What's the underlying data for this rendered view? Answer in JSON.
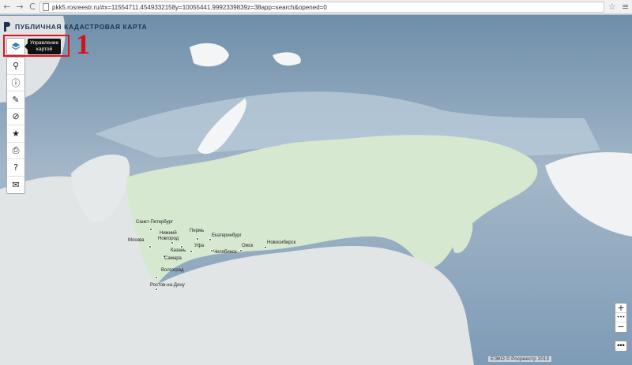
{
  "browser": {
    "back": "←",
    "forward": "→",
    "reload": "C",
    "url": "pkk5.rosreestr.ru/#x=11554711.4549332158y=10055441.9992339839z=38app=search&opened=0",
    "star": "☆",
    "menu": "≡"
  },
  "app": {
    "title": "ПУБЛИЧНАЯ КАДАСТРОВАЯ КАРТА"
  },
  "tooltip": {
    "text": "Управление картой"
  },
  "annotation": {
    "number": "1"
  },
  "toolbar": {
    "layers_icon": "layers-icon",
    "tools": [
      {
        "icon": "search-icon",
        "glyph": "⚲"
      },
      {
        "icon": "info-icon",
        "glyph": "ⓘ"
      },
      {
        "icon": "pencil-icon",
        "glyph": "✎"
      },
      {
        "icon": "no-measure-icon",
        "glyph": "⊘"
      },
      {
        "icon": "star-icon",
        "glyph": "★"
      },
      {
        "icon": "print-icon",
        "glyph": "⎙"
      },
      {
        "icon": "help-icon",
        "glyph": "?"
      },
      {
        "icon": "mail-icon",
        "glyph": "✉"
      }
    ]
  },
  "zoom": {
    "in": "+",
    "more": "•••",
    "out": "−"
  },
  "bottom_more": "•••",
  "copyright": "ЕЭКО © Росреестр 2013",
  "cities": [
    {
      "name": "Санкт-Петербург"
    },
    {
      "name": "Нижний"
    },
    {
      "name": "Новгород"
    },
    {
      "name": "Москва"
    },
    {
      "name": "Казань"
    },
    {
      "name": "Пермь"
    },
    {
      "name": "Уфа"
    },
    {
      "name": "Екатеринбург"
    },
    {
      "name": "Челябинск"
    },
    {
      "name": "Омск"
    },
    {
      "name": "Новосибирск"
    },
    {
      "name": "Самара"
    },
    {
      "name": "Волгоград"
    },
    {
      "name": "Ростов-на-Дону"
    }
  ],
  "colors": {
    "ocean": "#9fb3c6",
    "land": "#e2e5e6",
    "russia": "#d6e8cf",
    "ice": "#f4f5f6",
    "accent_red": "#e2141a"
  }
}
